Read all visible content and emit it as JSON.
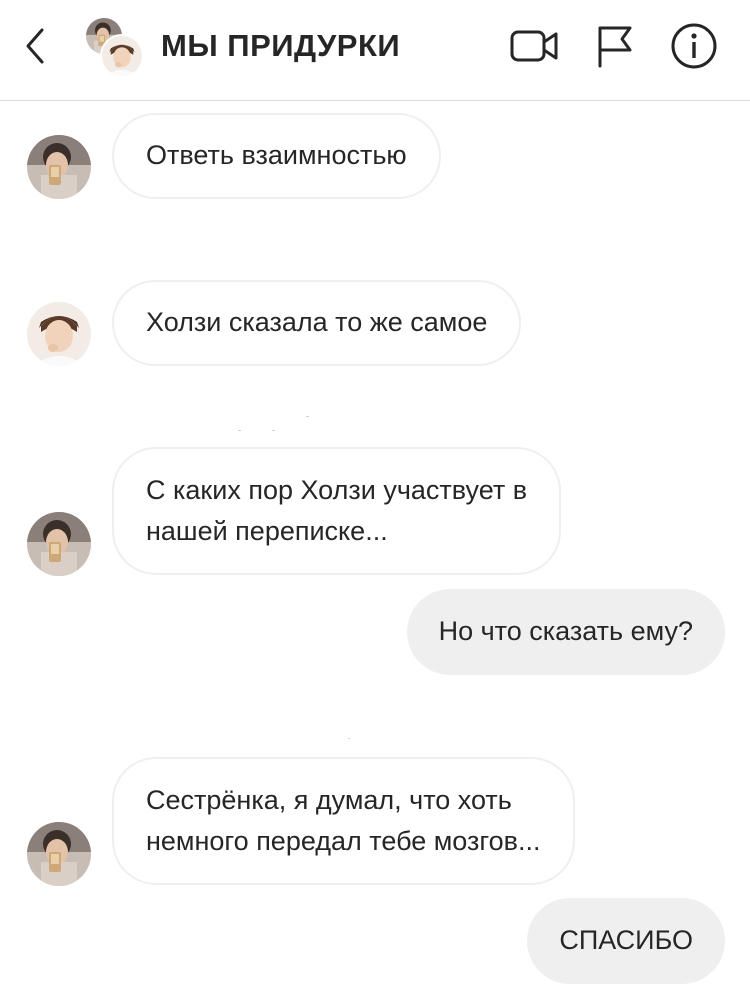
{
  "header": {
    "title": "МЫ ПРИДУРКИ",
    "icons": [
      "back-chevron-icon",
      "video-call-icon",
      "flag-icon",
      "info-icon"
    ]
  },
  "messages": [
    {
      "direction": "incoming",
      "lines": [
        "Ответь взаимностью"
      ]
    },
    {
      "direction": "incoming",
      "lines": [
        "Холзи сказала то же самое"
      ]
    },
    {
      "direction": "incoming",
      "lines": [
        "С каких пор Холзи участвует в",
        "нашей переписке..."
      ]
    },
    {
      "direction": "outgoing",
      "lines": [
        "Но что сказать ему?"
      ]
    },
    {
      "direction": "incoming",
      "lines": [
        "Сестрёнка, я думал, что хоть",
        "немного передал тебе мозгов..."
      ]
    },
    {
      "direction": "outgoing",
      "lines": [
        "СПАСИБО"
      ]
    }
  ],
  "colors": {
    "text": "#262626",
    "incoming_border": "#efefef",
    "outgoing_bg": "#efefef",
    "header_divider": "#dbdbdb"
  }
}
